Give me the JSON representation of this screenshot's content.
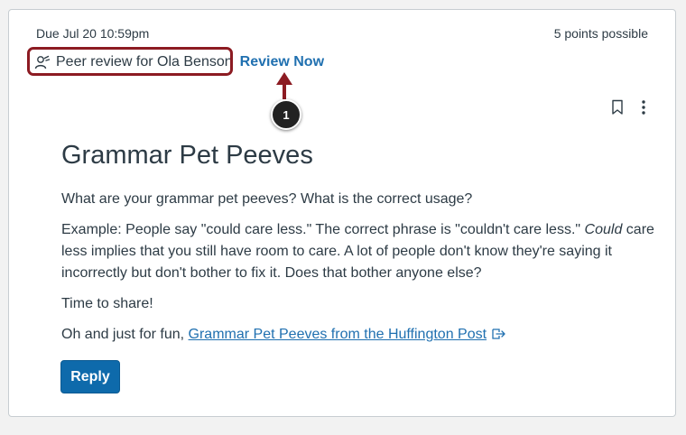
{
  "assignment": {
    "due": "Due Jul 20 10:59pm",
    "points": "5 points possible"
  },
  "peer_review": {
    "icon": "peer-review-icon",
    "text": "Peer review for Ola Benson",
    "link_label": "Review Now"
  },
  "annotation": {
    "callout_number": "1",
    "color": "#8c1b22"
  },
  "actions": {
    "bookmark_icon": "bookmark-icon",
    "more_icon": "kebab-menu-icon"
  },
  "discussion": {
    "title": "Grammar Pet Peeves",
    "paragraph_1": "What are your grammar pet peeves? What is the correct usage?",
    "paragraph_2_before": "Example: People say \"could care less.\" The correct phrase is \"couldn't care less.\" ",
    "paragraph_2_italic": "Could",
    "paragraph_2_after": " care less implies that you still have room to care. A lot of people don't know they're saying it incorrectly but don't bother to fix it. Does that bother anyone else?",
    "paragraph_3": "Time to share!",
    "paragraph_4_prefix": "Oh and just for fun, ",
    "link_text": "Grammar Pet Peeves from the Huffington Post",
    "link_icon": "external-link-icon"
  },
  "reply_label": "Reply",
  "colors": {
    "link": "#2070b0",
    "button": "#0e6aab",
    "text": "#2d3b45"
  }
}
